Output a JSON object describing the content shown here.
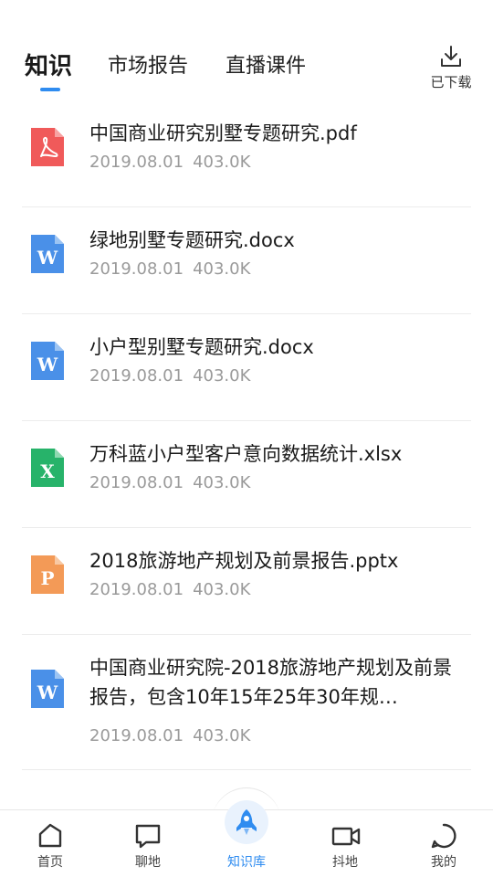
{
  "tabs": [
    {
      "label": "知识",
      "active": true
    },
    {
      "label": "市场报告",
      "active": false
    },
    {
      "label": "直播课件",
      "active": false
    }
  ],
  "download": {
    "label": "已下载",
    "icon": "download-icon"
  },
  "files": [
    {
      "name": "中国商业研究别墅专题研究.pdf",
      "date": "2019.08.01",
      "size": "403.0K",
      "type": "pdf",
      "icon_letter": "",
      "color": "#f05a5a"
    },
    {
      "name": "绿地别墅专题研究.docx",
      "date": "2019.08.01",
      "size": "403.0K",
      "type": "word",
      "icon_letter": "W",
      "color": "#4a90e8"
    },
    {
      "name": "小户型别墅专题研究.docx",
      "date": "2019.08.01",
      "size": "403.0K",
      "type": "word",
      "icon_letter": "W",
      "color": "#4a90e8"
    },
    {
      "name": "万科蓝小户型客户意向数据统计.xlsx",
      "date": "2019.08.01",
      "size": "403.0K",
      "type": "excel",
      "icon_letter": "X",
      "color": "#27b36a"
    },
    {
      "name": "2018旅游地产规划及前景报告.pptx",
      "date": "2019.08.01",
      "size": "403.0K",
      "type": "ppt",
      "icon_letter": "P",
      "color": "#f39a57"
    },
    {
      "name": "中国商业研究院-2018旅游地产规划及前景报告，包含10年15年25年30年规…",
      "date": "2019.08.01",
      "size": "403.0K",
      "type": "word",
      "icon_letter": "W",
      "color": "#4a90e8"
    }
  ],
  "nav": [
    {
      "label": "首页",
      "icon": "home-icon",
      "active": false
    },
    {
      "label": "聊地",
      "icon": "chat-icon",
      "active": false
    },
    {
      "label": "知识库",
      "icon": "rocket-icon",
      "active": true
    },
    {
      "label": "抖地",
      "icon": "video-icon",
      "active": false
    },
    {
      "label": "我的",
      "icon": "profile-icon",
      "active": false
    }
  ],
  "colors": {
    "accent": "#2f8cf0",
    "divider": "#ececec",
    "meta": "#9a9a9a"
  }
}
